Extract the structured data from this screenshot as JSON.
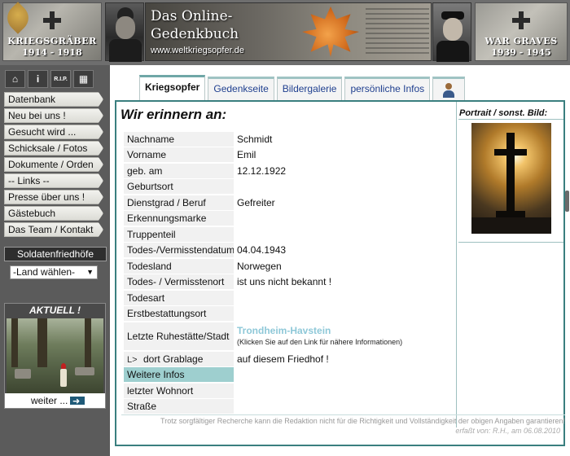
{
  "header": {
    "left_label": "KRIEGSGRÄBER",
    "left_years": "1914 - 1918",
    "title_line1": "Das Online-",
    "title_line2": "Gedenkbuch",
    "url": "www.weltkriegsopfer.de",
    "right_label": "WAR GRAVES",
    "right_years": "1939 - 1945"
  },
  "sidebar": {
    "icons": [
      "home-icon",
      "info-icon",
      "rip-icon",
      "clapper-icon"
    ],
    "info_label": "i",
    "rip_label": "R.I.P.",
    "nav": [
      "Datenbank",
      "Neu bei uns !",
      "Gesucht wird ...",
      "Schicksale / Fotos",
      "Dokumente / Orden",
      "-- Links --",
      "Presse über uns !",
      "Gästebuch",
      "Das Team / Kontakt"
    ],
    "cemetery_header": "Soldatenfriedhöfe",
    "land_select": "-Land wählen-",
    "aktuell_title": "AKTUELL !",
    "weiter_label": "weiter ..."
  },
  "tabs": [
    {
      "label": "Kriegsopfer",
      "active": true
    },
    {
      "label": "Gedenkseite",
      "active": false
    },
    {
      "label": "Bildergalerie",
      "active": false
    },
    {
      "label": "persönliche Infos",
      "active": false
    }
  ],
  "content": {
    "title": "Wir erinnern an:",
    "rows": [
      {
        "label": "Nachname",
        "value": "Schmidt"
      },
      {
        "label": "Vorname",
        "value": "Emil"
      },
      {
        "label": "geb. am",
        "value": "12.12.1922"
      },
      {
        "label": "Geburtsort",
        "value": ""
      },
      {
        "label": "Dienstgrad / Beruf",
        "value": "Gefreiter"
      },
      {
        "label": "Erkennungsmarke",
        "value": ""
      },
      {
        "label": "Truppenteil",
        "value": ""
      },
      {
        "label": "Todes-/Vermisstendatum",
        "value": "04.04.1943"
      },
      {
        "label": "Todesland",
        "value": "Norwegen"
      },
      {
        "label": "Todes- / Vermisstenort",
        "value": "ist uns nicht bekannt !"
      },
      {
        "label": "Todesart",
        "value": ""
      },
      {
        "label": "Erstbestattungsort",
        "value": ""
      }
    ],
    "resting_label": "Letzte Ruhestätte/Stadt",
    "resting_link": "Trondheim-Havstein",
    "resting_hint": "(Klicken Sie auf den Link für nähere Informationen)",
    "grave_arrow": "L>",
    "grave_label": "dort Grablage",
    "grave_value": "auf diesem Friedhof !",
    "more_info": "Weitere Infos",
    "last_residence": "letzter Wohnort",
    "street": "Straße",
    "portrait_header": "Portrait / sonst. Bild:",
    "disclaimer": "Trotz sorgfältiger Recherche kann die Redaktion nicht für die Richtigkeit und Vollständigkeit der obigen Angaben garantieren!",
    "erfasst": "erfaßt von: R.H., am 06.08.2010"
  }
}
